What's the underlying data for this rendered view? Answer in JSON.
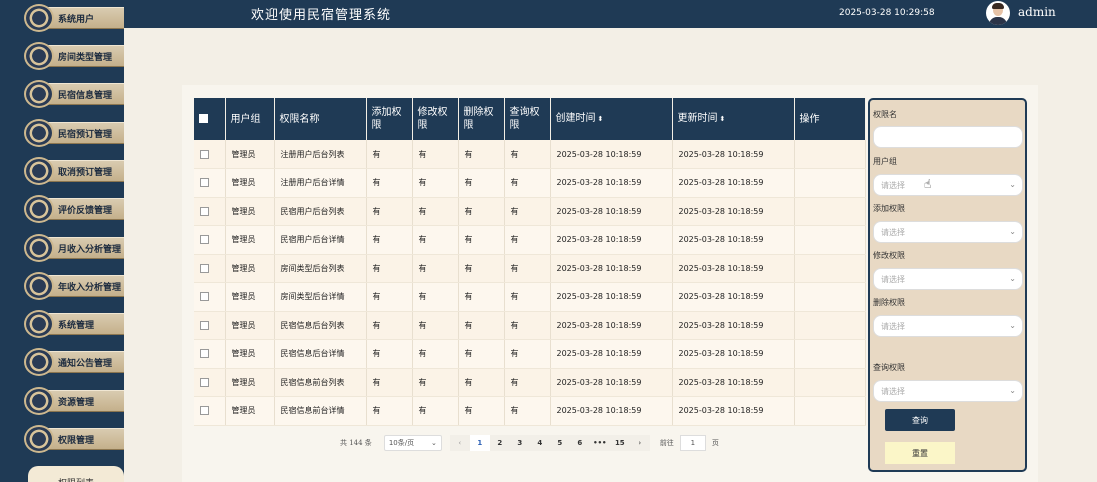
{
  "sidebar": {
    "items": [
      {
        "label": "系统用户"
      },
      {
        "label": "房间类型管理"
      },
      {
        "label": "民宿信息管理"
      },
      {
        "label": "民宿预订管理"
      },
      {
        "label": "取消预订管理"
      },
      {
        "label": "评价反馈管理"
      },
      {
        "label": "月收入分析管理"
      },
      {
        "label": "年收入分析管理"
      },
      {
        "label": "系统管理"
      },
      {
        "label": "通知公告管理"
      },
      {
        "label": "资源管理"
      },
      {
        "label": "权限管理"
      }
    ],
    "bottom_label": "权限列表"
  },
  "header": {
    "title": "欢迎使用民宿管理系统",
    "datetime": "2025-03-28 10:29:58",
    "username": "admin"
  },
  "table": {
    "headers": [
      "用户组",
      "权限名称",
      "添加权限",
      "修改权限",
      "删除权限",
      "查询权限",
      "创建时间",
      "更新时间",
      "操作"
    ],
    "sort_icon": "⬍",
    "rows": [
      {
        "group": "管理员",
        "name": "注册用户后台列表",
        "add": "有",
        "edit": "有",
        "del": "有",
        "query": "有",
        "created": "2025-03-28 10:18:59",
        "updated": "2025-03-28 10:18:59"
      },
      {
        "group": "管理员",
        "name": "注册用户后台详情",
        "add": "有",
        "edit": "有",
        "del": "有",
        "query": "有",
        "created": "2025-03-28 10:18:59",
        "updated": "2025-03-28 10:18:59"
      },
      {
        "group": "管理员",
        "name": "民宿用户后台列表",
        "add": "有",
        "edit": "有",
        "del": "有",
        "query": "有",
        "created": "2025-03-28 10:18:59",
        "updated": "2025-03-28 10:18:59"
      },
      {
        "group": "管理员",
        "name": "民宿用户后台详情",
        "add": "有",
        "edit": "有",
        "del": "有",
        "query": "有",
        "created": "2025-03-28 10:18:59",
        "updated": "2025-03-28 10:18:59"
      },
      {
        "group": "管理员",
        "name": "房间类型后台列表",
        "add": "有",
        "edit": "有",
        "del": "有",
        "query": "有",
        "created": "2025-03-28 10:18:59",
        "updated": "2025-03-28 10:18:59"
      },
      {
        "group": "管理员",
        "name": "房间类型后台详情",
        "add": "有",
        "edit": "有",
        "del": "有",
        "query": "有",
        "created": "2025-03-28 10:18:59",
        "updated": "2025-03-28 10:18:59"
      },
      {
        "group": "管理员",
        "name": "民宿信息后台列表",
        "add": "有",
        "edit": "有",
        "del": "有",
        "query": "有",
        "created": "2025-03-28 10:18:59",
        "updated": "2025-03-28 10:18:59"
      },
      {
        "group": "管理员",
        "name": "民宿信息后台详情",
        "add": "有",
        "edit": "有",
        "del": "有",
        "query": "有",
        "created": "2025-03-28 10:18:59",
        "updated": "2025-03-28 10:18:59"
      },
      {
        "group": "管理员",
        "name": "民宿信息前台列表",
        "add": "有",
        "edit": "有",
        "del": "有",
        "query": "有",
        "created": "2025-03-28 10:18:59",
        "updated": "2025-03-28 10:18:59"
      },
      {
        "group": "管理员",
        "name": "民宿信息前台详情",
        "add": "有",
        "edit": "有",
        "del": "有",
        "query": "有",
        "created": "2025-03-28 10:18:59",
        "updated": "2025-03-28 10:18:59"
      }
    ]
  },
  "pagination": {
    "total": "共 144 条",
    "page_size": "10条/页",
    "pages": [
      "1",
      "2",
      "3",
      "4",
      "5",
      "6",
      "•••",
      "15"
    ],
    "prev": "‹",
    "next": "›",
    "goto_label": "前往",
    "goto_value": "1",
    "page_unit": "页"
  },
  "filter": {
    "name_label": "权限名",
    "name_value": "",
    "group_label": "用户组",
    "add_label": "添加权限",
    "edit_label": "修改权限",
    "del_label": "删除权限",
    "query_label": "查询权限",
    "select_placeholder": "请选择",
    "query_button": "查询",
    "reset_button": "重置"
  },
  "colors": {
    "primary": "#1f3a55",
    "panel": "#e8d9c4"
  }
}
